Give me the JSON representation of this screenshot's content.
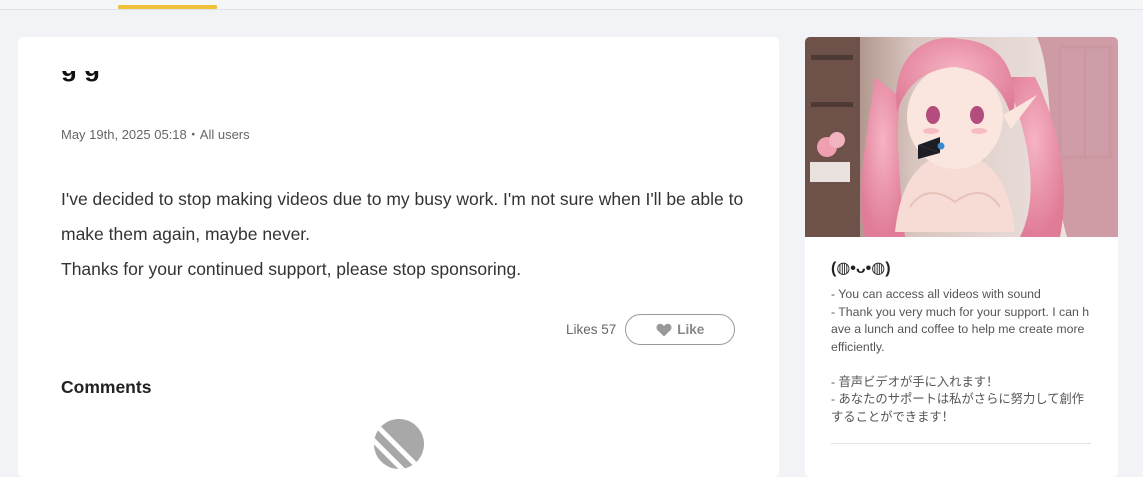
{
  "post": {
    "title": "g g",
    "date": "May 19th, 2025 05:18",
    "separator": "・",
    "audience": "All users",
    "body": [
      "I've decided to stop making videos due to my busy work. I'm not sure when I'll be able to make them again, maybe never.",
      "Thanks for your continued support, please stop sponsoring."
    ],
    "likes_label": "Likes",
    "likes_count": "57",
    "like_button_label": "Like"
  },
  "comments": {
    "heading": "Comments"
  },
  "tier": {
    "title": "(◍•ᴗ•◍)",
    "description": [
      "- You can access all videos with sound",
      "- Thank you very much for your support. I can have a lunch and coffee to help me create more efficiently.",
      "",
      "- 音声ビデオが手に入れます！",
      "- あなたのサポートは私がさらに努力して創作することができます！"
    ]
  },
  "icons": {
    "like": "heart-icon",
    "no_comments": "no-comments-icon",
    "tier_image": "anime-character-illustration"
  },
  "colors": {
    "accent": "#f0c23a",
    "background": "#f2f3f7",
    "card": "#ffffff",
    "text": "#333333",
    "muted": "#666666"
  }
}
